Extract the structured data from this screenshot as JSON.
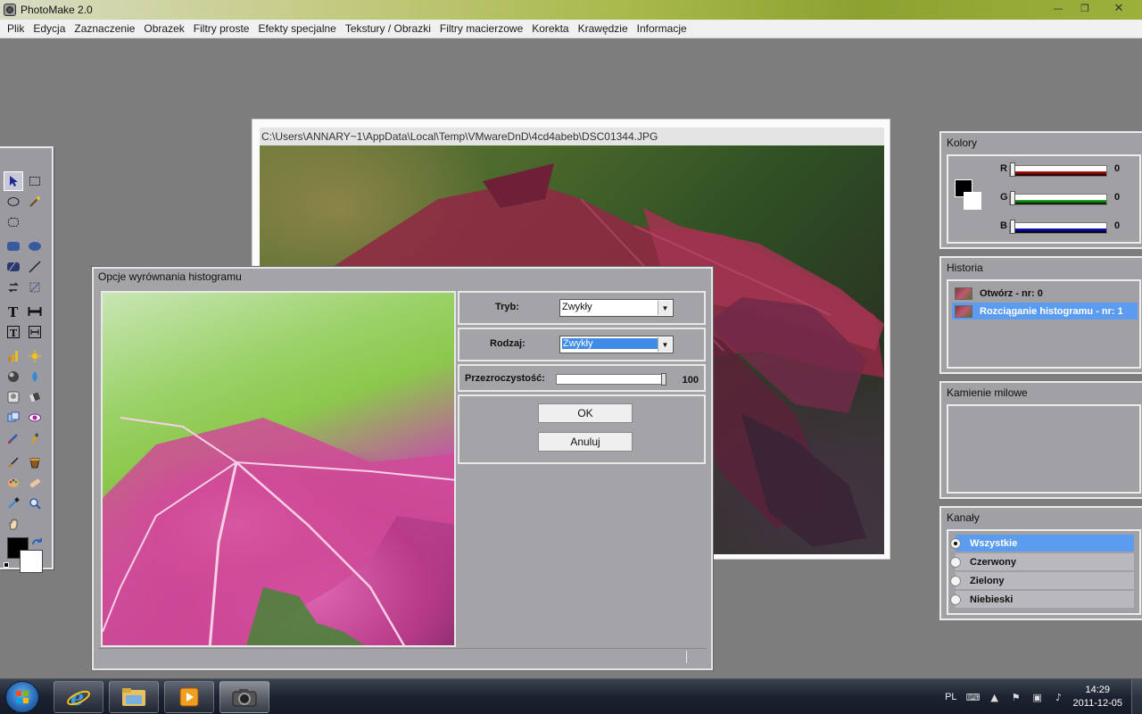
{
  "app": {
    "title": "PhotoMake 2.0",
    "window_controls": {
      "minimize": "—",
      "maximize": "❐",
      "close": "✕"
    }
  },
  "menu": [
    "Plik",
    "Edycja",
    "Zaznaczenie",
    "Obrazek",
    "Filtry proste",
    "Efekty specjalne",
    "Tekstury / Obrazki",
    "Filtry macierzowe",
    "Korekta",
    "Krawędzie",
    "Informacje"
  ],
  "image_window": {
    "path": "C:\\Users\\ANNARY~1\\AppData\\Local\\Temp\\VMwareDnD\\4cd4abeb\\DSC01344.JPG"
  },
  "dialog": {
    "title": "Opcje wyrównania histogramu",
    "tryb_label": "Tryb:",
    "tryb_value": "Zwykły",
    "rodzaj_label": "Rodzaj:",
    "rodzaj_value": "Zwykły",
    "opacity_label": "Przezroczystość:",
    "opacity_value": "100",
    "opacity_level": 1.0,
    "ok": "OK",
    "cancel": "Anuluj"
  },
  "panels": {
    "colors": {
      "title": "Kolory",
      "r_label": "R",
      "r_value": "0",
      "g_label": "G",
      "g_value": "0",
      "b_label": "B",
      "b_value": "0",
      "r_color": "#cc1111",
      "g_color": "#22bb22",
      "b_color": "#1111cc"
    },
    "history": {
      "title": "Historia",
      "items": [
        {
          "label": "Otwórz - nr: 0",
          "active": false
        },
        {
          "label": "Rozciąganie histogramu - nr: 1",
          "active": true
        }
      ]
    },
    "milestones": {
      "title": "Kamienie milowe"
    },
    "channels": {
      "title": "Kanały",
      "items": [
        {
          "label": "Wszystkie",
          "selected": true
        },
        {
          "label": "Czerwony",
          "selected": false
        },
        {
          "label": "Zielony",
          "selected": false
        },
        {
          "label": "Niebieski",
          "selected": false
        }
      ]
    }
  },
  "taskbar": {
    "language": "PL",
    "time": "14:29",
    "date": "2011-12-05",
    "apps": [
      "internet-explorer",
      "windows-explorer",
      "media-player",
      "photomake"
    ]
  }
}
